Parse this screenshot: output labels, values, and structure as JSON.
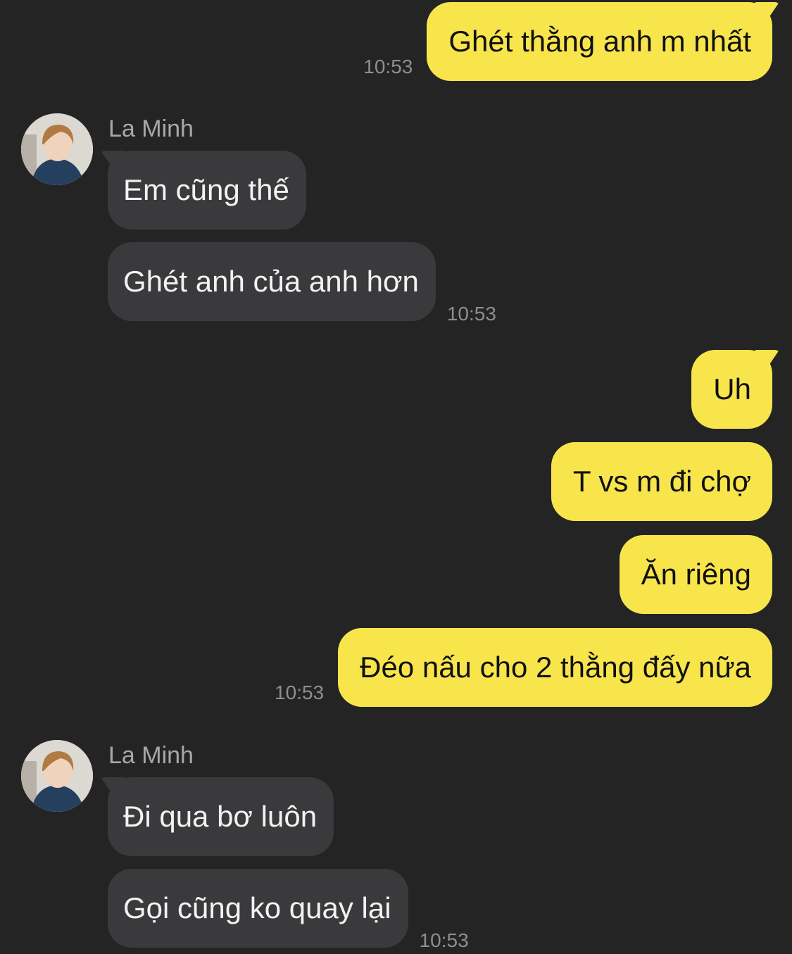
{
  "colors": {
    "background": "#242424",
    "outgoing_bubble": "#F8E54C",
    "incoming_bubble": "#3A3A3C",
    "timestamp": "#8E8E8E"
  },
  "messages": [
    {
      "direction": "out",
      "text": "Ghét thằng anh m nhất",
      "time": "10:53"
    },
    {
      "direction": "in",
      "sender": "La Minh",
      "avatar": "profile-photo",
      "text": "Em cũng thế"
    },
    {
      "direction": "in",
      "text": "Ghét anh của anh hơn",
      "time": "10:53"
    },
    {
      "direction": "out",
      "text": "Uh"
    },
    {
      "direction": "out",
      "text": "T vs m đi chợ"
    },
    {
      "direction": "out",
      "text": "Ăn riêng"
    },
    {
      "direction": "out",
      "text": "Đéo nấu cho 2 thằng đấy nữa",
      "time": "10:53"
    },
    {
      "direction": "in",
      "sender": "La Minh",
      "avatar": "profile-photo",
      "text": "Đi qua bơ luôn"
    },
    {
      "direction": "in",
      "text": "Gọi cũng ko quay lại",
      "time": "10:53"
    }
  ]
}
